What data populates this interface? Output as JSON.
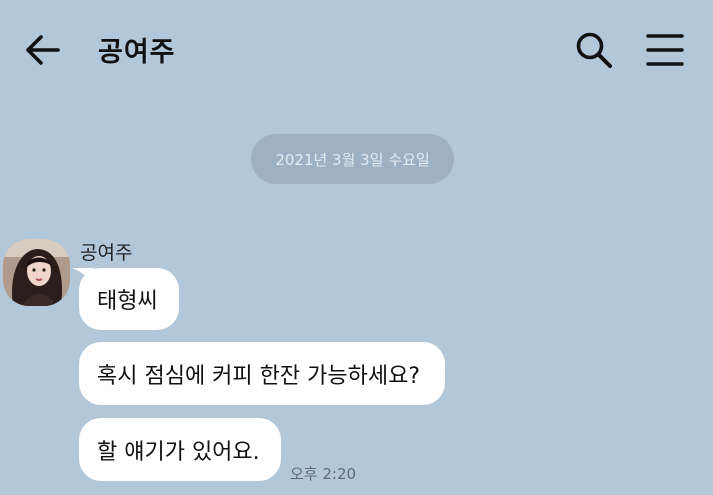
{
  "header": {
    "title": "공여주",
    "back_icon": "arrow-left-icon",
    "search_icon": "search-icon",
    "menu_icon": "hamburger-menu-icon"
  },
  "date_divider": "2021년 3월 3일 수요일",
  "message_group": {
    "sender_name": "공여주",
    "messages": [
      "태형씨",
      "혹시 점심에 커피 한잔 가능하세요?",
      "할 얘기가 있어요."
    ],
    "time": "오후 2:20"
  },
  "colors": {
    "background": "#b2c7d9",
    "bubble": "#ffffff",
    "date_pill": "#9db1c3"
  }
}
